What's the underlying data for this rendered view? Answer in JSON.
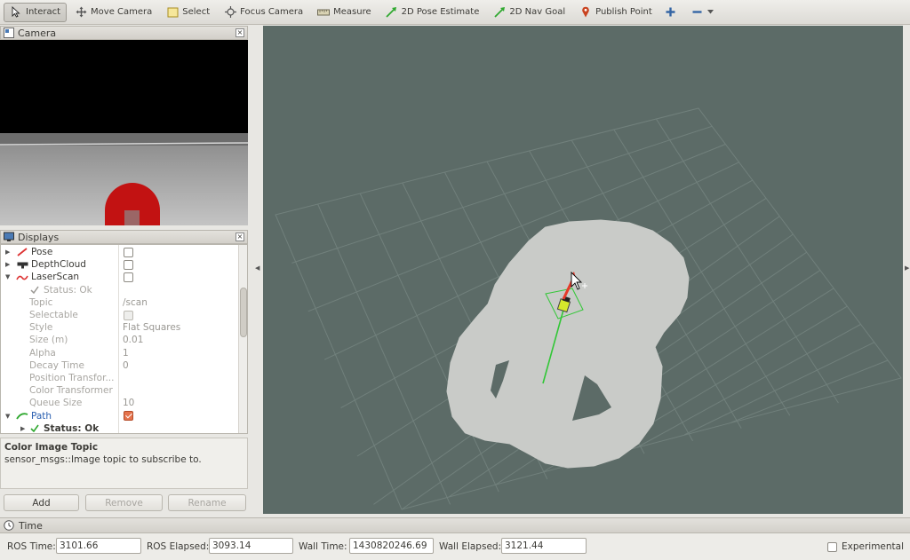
{
  "toolbar": {
    "tools": [
      {
        "label": "Interact",
        "icon": "cursor-icon",
        "active": true
      },
      {
        "label": "Move Camera",
        "icon": "move-camera-icon"
      },
      {
        "label": "Select",
        "icon": "select-icon"
      },
      {
        "label": "Focus Camera",
        "icon": "focus-camera-icon"
      },
      {
        "label": "Measure",
        "icon": "measure-icon"
      },
      {
        "label": "2D Pose Estimate",
        "icon": "pose-arrow-icon"
      },
      {
        "label": "2D Nav Goal",
        "icon": "nav-goal-arrow-icon"
      },
      {
        "label": "Publish Point",
        "icon": "map-pin-icon"
      }
    ],
    "add_icon": "plus-icon",
    "remove_icon": "minus-icon",
    "dropdown_icon": "chevron-down-icon"
  },
  "camera_panel": {
    "title": "Camera"
  },
  "displays_panel": {
    "title": "Displays",
    "rows": [
      {
        "name": "Pose",
        "type": "display",
        "icon": "pose-icon",
        "checked": false
      },
      {
        "name": "DepthCloud",
        "type": "display",
        "icon": "depthcloud-icon",
        "checked": false
      },
      {
        "name": "LaserScan",
        "type": "display",
        "icon": "laserscan-icon",
        "checked": false,
        "expanded": true
      },
      {
        "name": "Status: Ok",
        "type": "status"
      },
      {
        "name": "Topic",
        "value": "/scan",
        "type": "prop"
      },
      {
        "name": "Selectable",
        "type": "prop-check"
      },
      {
        "name": "Style",
        "value": "Flat Squares",
        "type": "prop"
      },
      {
        "name": "Size (m)",
        "value": "0.01",
        "type": "prop"
      },
      {
        "name": "Alpha",
        "value": "1",
        "type": "prop"
      },
      {
        "name": "Decay Time",
        "value": "0",
        "type": "prop"
      },
      {
        "name": "Position Transfor...",
        "value": "",
        "type": "prop"
      },
      {
        "name": "Color Transformer",
        "value": "",
        "type": "prop"
      },
      {
        "name": "Queue Size",
        "value": "10",
        "type": "prop"
      },
      {
        "name": "Path",
        "type": "display",
        "icon": "path-icon",
        "checked": true,
        "expanded": true
      },
      {
        "name": "Status: Ok",
        "type": "status-bold"
      }
    ]
  },
  "description": {
    "title": "Color Image Topic",
    "text": "sensor_msgs::Image topic to subscribe to."
  },
  "buttons": {
    "add": "Add",
    "remove": "Remove",
    "rename": "Rename"
  },
  "time_panel": {
    "title": "Time",
    "ros_time_label": "ROS Time:",
    "ros_time": "3101.66",
    "ros_elapsed_label": "ROS Elapsed:",
    "ros_elapsed": "3093.14",
    "wall_time_label": "Wall Time:",
    "wall_time": "1430820246.69",
    "wall_elapsed_label": "Wall Elapsed:",
    "wall_elapsed": "3121.44",
    "experimental_label": "Experimental",
    "experimental_checked": false
  },
  "colors": {
    "view_background": "#5c6b67",
    "map_free": "#c9cbc8",
    "path_green": "#31c736",
    "pose_red": "#e63a2a"
  }
}
